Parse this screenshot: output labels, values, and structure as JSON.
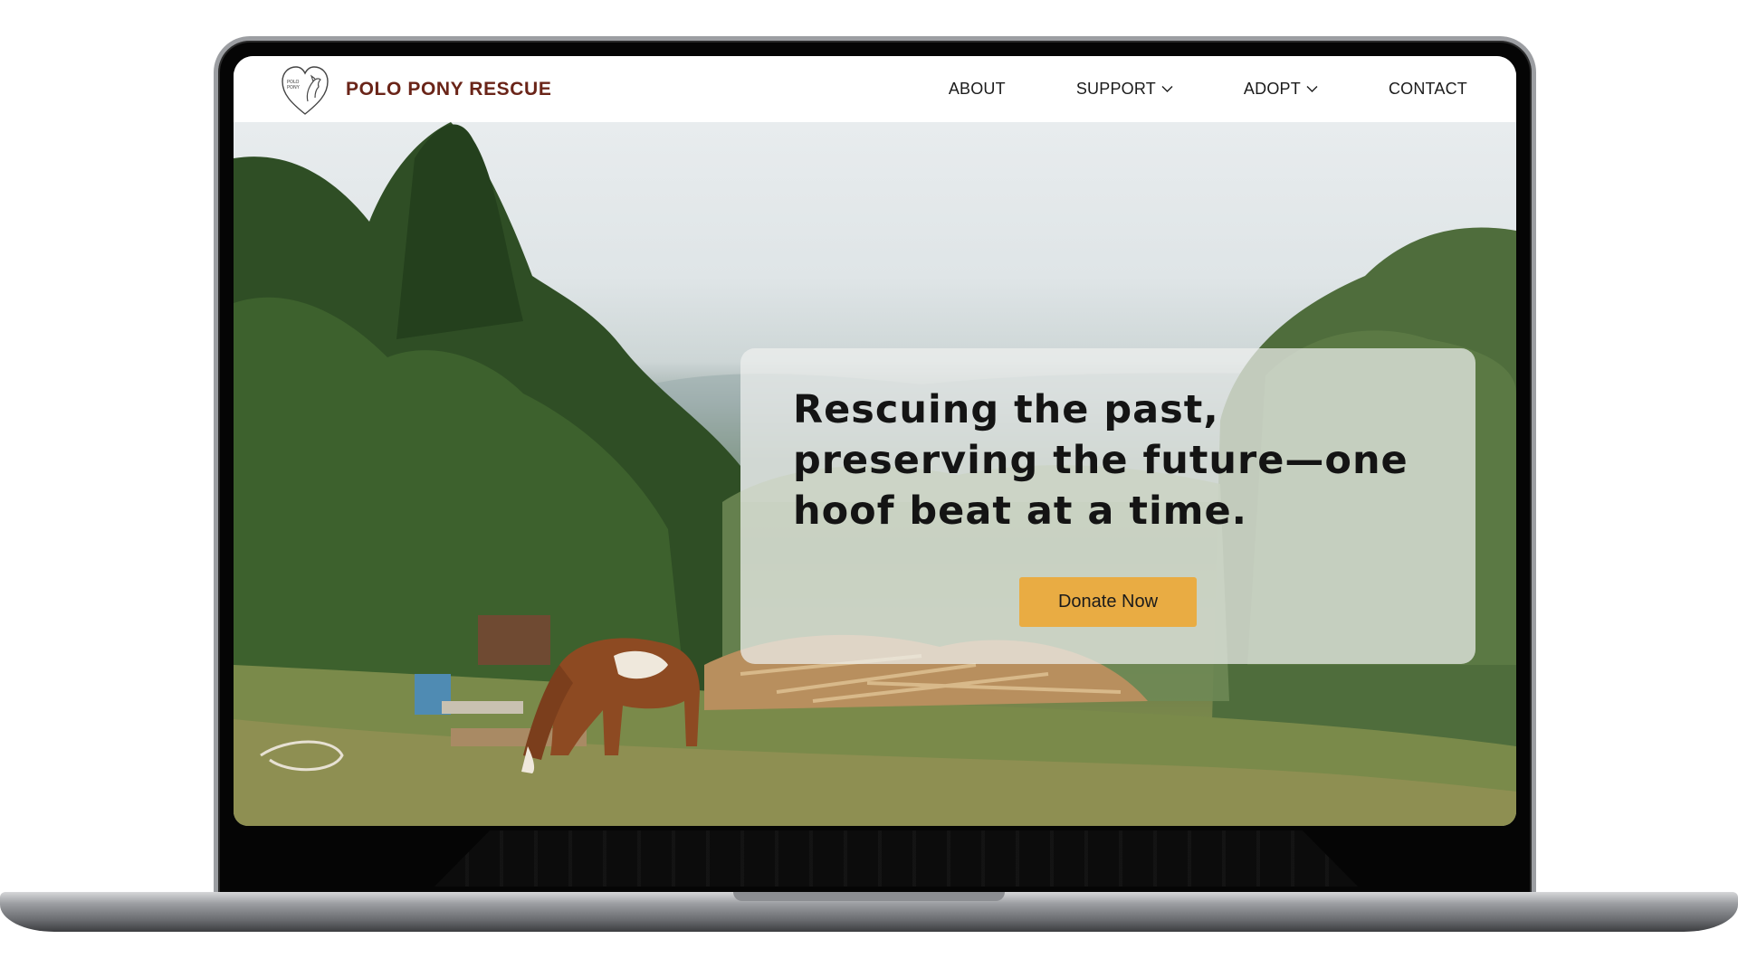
{
  "brand": {
    "name": "POLO PONY RESCUE",
    "logo_icon": "heart-horse-logo",
    "color": "#6a2418"
  },
  "nav": {
    "items": [
      {
        "label": "ABOUT",
        "has_dropdown": false
      },
      {
        "label": "SUPPORT",
        "has_dropdown": true,
        "icon": "chevron-down-icon"
      },
      {
        "label": "ADOPT",
        "has_dropdown": true,
        "icon": "chevron-down-icon"
      },
      {
        "label": "CONTACT",
        "has_dropdown": false
      }
    ]
  },
  "hero": {
    "headline": "Rescuing the past, preserving the future—one hoof beat at a time.",
    "cta_label": "Donate Now",
    "cta_color": "#e9ac43",
    "image_subject": "pinto horse grazing near woodpile in forest clearing"
  }
}
